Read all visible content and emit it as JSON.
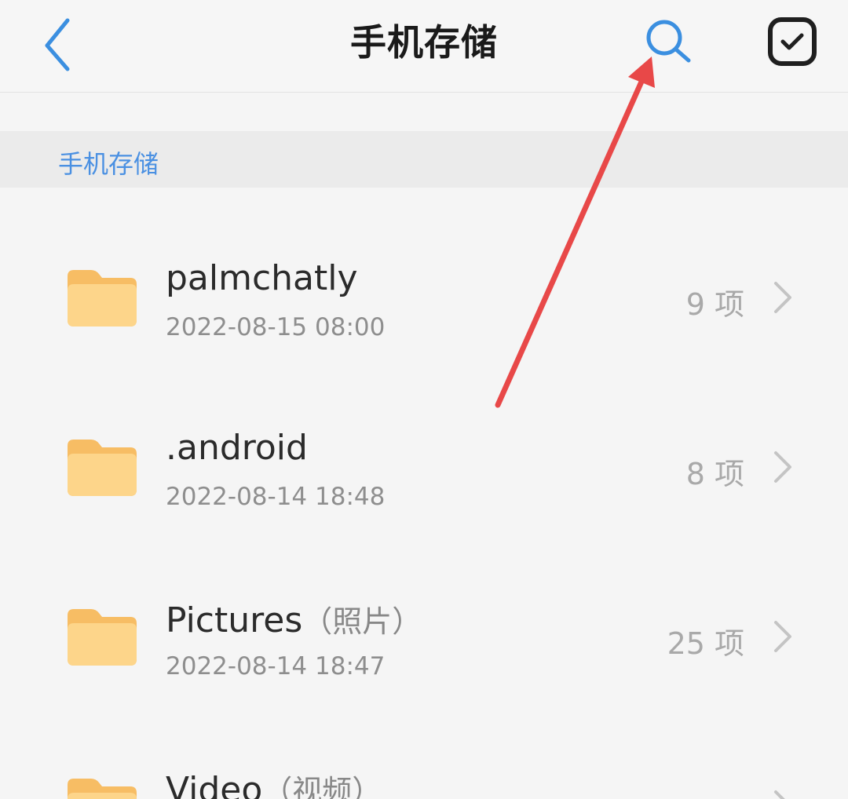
{
  "header": {
    "title": "手机存储",
    "back_icon": "chevron-left-icon",
    "search_icon": "search-icon",
    "select_icon": "checkbox-icon"
  },
  "breadcrumb": {
    "label": "手机存储"
  },
  "files": [
    {
      "name": "palmchatly",
      "name_zh": "",
      "date": "2022-08-15 08:00",
      "count": "9 项"
    },
    {
      "name": ".android",
      "name_zh": "",
      "date": "2022-08-14 18:48",
      "count": "8 项"
    },
    {
      "name": "Pictures",
      "name_zh": "（照片）",
      "date": "2022-08-14 18:47",
      "count": "25 项"
    },
    {
      "name": "Video",
      "name_zh": "（视频）",
      "date": "",
      "count": ""
    }
  ],
  "colors": {
    "accent": "#4a90e2",
    "folder": "#fdd58a",
    "folder_tab": "#f7bd64",
    "annotation_arrow": "#e84848"
  }
}
